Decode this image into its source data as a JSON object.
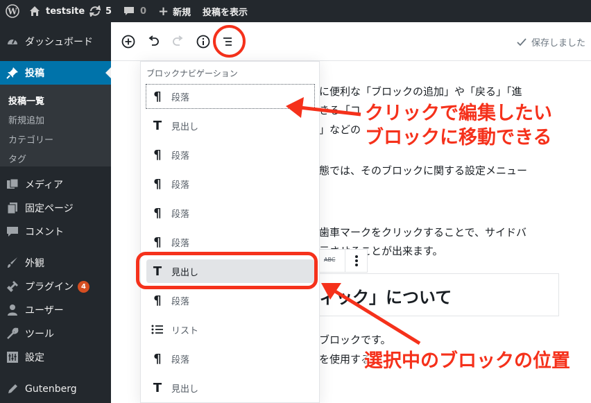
{
  "admin_bar": {
    "site_name": "testsite",
    "updates_count": "5",
    "comments_count": "0",
    "new_label": "新規",
    "view_post_label": "投稿を表示"
  },
  "sidebar": {
    "items": [
      {
        "label": "ダッシュボード",
        "icon": "dashboard-icon"
      },
      {
        "label": "投稿",
        "icon": "pin-icon"
      },
      {
        "label": "メディア",
        "icon": "media-icon"
      },
      {
        "label": "固定ページ",
        "icon": "pages-icon"
      },
      {
        "label": "コメント",
        "icon": "comment-icon"
      },
      {
        "label": "外観",
        "icon": "brush-icon"
      },
      {
        "label": "プラグイン",
        "icon": "plugin-icon",
        "badge": "4"
      },
      {
        "label": "ユーザー",
        "icon": "user-icon"
      },
      {
        "label": "ツール",
        "icon": "wrench-icon"
      },
      {
        "label": "設定",
        "icon": "settings-icon"
      },
      {
        "label": "Gutenberg",
        "icon": "pencil-icon"
      }
    ],
    "submenu": [
      "投稿一覧",
      "新規追加",
      "カテゴリー",
      "タグ"
    ]
  },
  "toolbar": {
    "saved_label": "保存しました"
  },
  "block_navigation": {
    "title": "ブロックナビゲーション",
    "items": [
      {
        "label": "段落",
        "icon": "paragraph-icon"
      },
      {
        "label": "見出し",
        "icon": "heading-icon"
      },
      {
        "label": "段落",
        "icon": "paragraph-icon"
      },
      {
        "label": "段落",
        "icon": "paragraph-icon"
      },
      {
        "label": "段落",
        "icon": "paragraph-icon"
      },
      {
        "label": "段落",
        "icon": "paragraph-icon"
      },
      {
        "label": "見出し",
        "icon": "heading-icon"
      },
      {
        "label": "段落",
        "icon": "paragraph-icon"
      },
      {
        "label": "リスト",
        "icon": "list-icon"
      },
      {
        "label": "段落",
        "icon": "paragraph-icon"
      },
      {
        "label": "見出し",
        "icon": "heading-icon"
      }
    ]
  },
  "content": {
    "lines": [
      "に便利な「ブロックの追加」や「戻る」「進",
      "きる「コ",
      "」などの",
      "態では、そのブロックに関する設定メニュー",
      "歯車マークをクリックすることで、サイドバ",
      "示させることが出来ます。",
      "ブロックです。",
      "を使用する"
    ],
    "heading": "ィック」について",
    "toolbar_abc": "ABC"
  },
  "annotations": {
    "top_line1": "クリックで編集したい",
    "top_line2": "ブロックに移動できる",
    "bottom": "選択中のブロックの位置"
  },
  "colors": {
    "admin_dark": "#23282d",
    "accent_blue": "#0073aa",
    "annotation_red": "#f5311b"
  }
}
